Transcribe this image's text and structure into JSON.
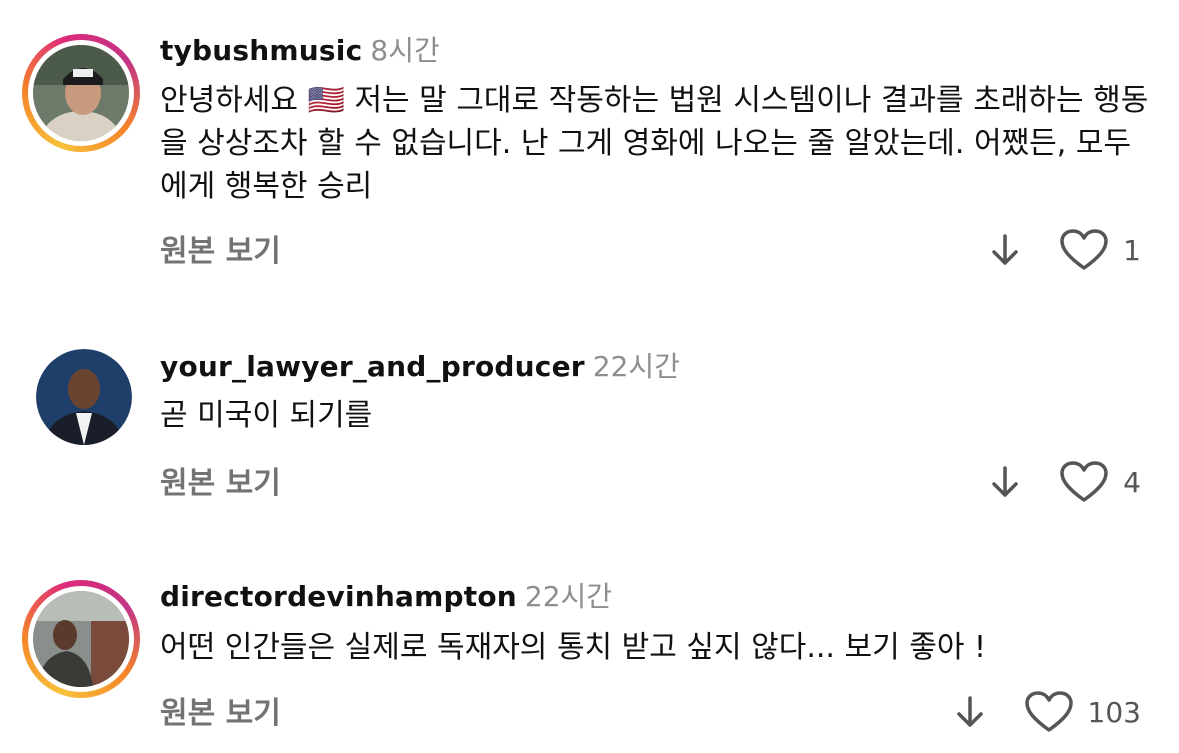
{
  "comments": [
    {
      "username": "tybushmusic",
      "time": "8시간",
      "text_before_flag": "안녕하세요 ",
      "flag": "🇺🇸",
      "text": " 저는 말 그대로 작동하는 법원 시스템이나 결과를 초래하는 행동을 상상조차 할 수 없습니다. 난 그게 영화에 나오는 줄 알았는데. 어쨌든, 모두에게 행복한 승리",
      "see_original": "원본 보기",
      "likes": "1",
      "story_ring": true
    },
    {
      "username": "your_lawyer_and_producer",
      "time": "22시간",
      "text": "곧 미국이 되기를",
      "see_original": "원본 보기",
      "likes": "4",
      "story_ring": false
    },
    {
      "username": "directordevinhampton",
      "time": "22시간",
      "text": "어떤 인간들은 실제로 독재자의 통치 받고 싶지 않다... 보기 좋아 !",
      "see_original": "원본 보기",
      "likes": "103",
      "story_ring": true
    }
  ],
  "icons": {
    "down": "arrow-down-icon",
    "like": "heart-icon"
  },
  "colors": {
    "username": "#111111",
    "meta": "#8e8e8e",
    "see_original": "#737373"
  }
}
